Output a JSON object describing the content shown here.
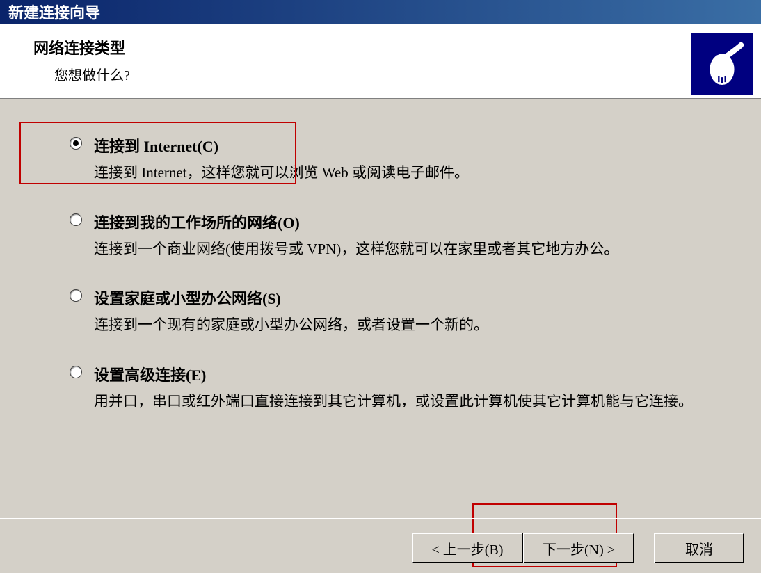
{
  "window": {
    "title": "新建连接向导"
  },
  "header": {
    "title": "网络连接类型",
    "subtitle": "您想做什么?"
  },
  "options": [
    {
      "label": "连接到 Internet(C)",
      "desc": "连接到 Internet，这样您就可以浏览 Web 或阅读电子邮件。",
      "selected": true
    },
    {
      "label": "连接到我的工作场所的网络(O)",
      "desc": "连接到一个商业网络(使用拨号或 VPN)，这样您就可以在家里或者其它地方办公。",
      "selected": false
    },
    {
      "label": "设置家庭或小型办公网络(S)",
      "desc": "连接到一个现有的家庭或小型办公网络，或者设置一个新的。",
      "selected": false
    },
    {
      "label": "设置高级连接(E)",
      "desc": "用并口，串口或红外端口直接连接到其它计算机，或设置此计算机使其它计算机能与它连接。",
      "selected": false
    }
  ],
  "footer": {
    "back": "< 上一步(B)",
    "next": "下一步(N) >",
    "cancel": "取消"
  }
}
